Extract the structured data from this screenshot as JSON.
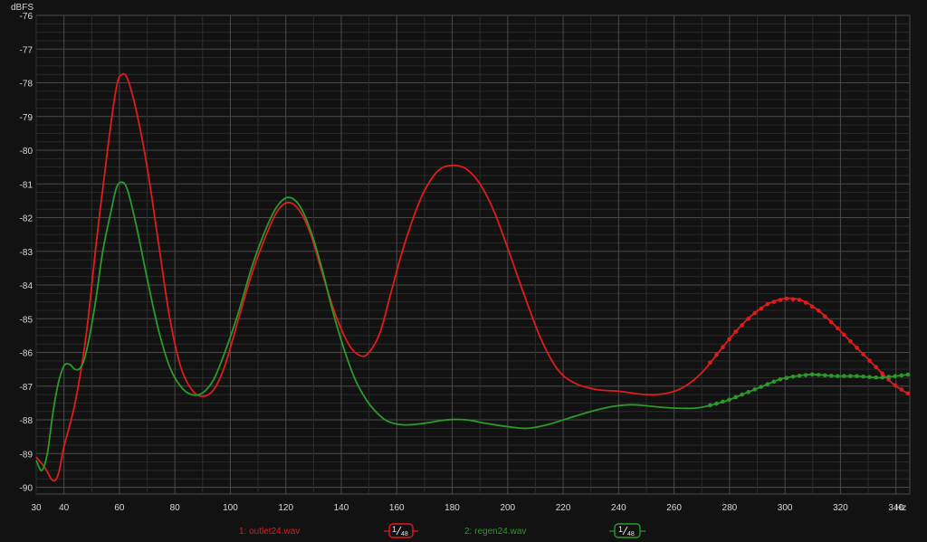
{
  "chart_data": {
    "type": "line",
    "y_unit": "dBFS",
    "x_unit": "Hz",
    "xlim": [
      30,
      345
    ],
    "ylim": [
      -90.2,
      -76
    ],
    "x_ticks": [
      "30",
      "40",
      "60",
      "80",
      "100",
      "120",
      "140",
      "160",
      "180",
      "200",
      "220",
      "240",
      "260",
      "280",
      "300",
      "320",
      "340"
    ],
    "y_ticks": [
      "-76",
      "-77",
      "-78",
      "-79",
      "-80",
      "-81",
      "-82",
      "-83",
      "-84",
      "-85",
      "-86",
      "-87",
      "-88",
      "-89",
      "-90"
    ],
    "grid": true,
    "background": "#121212",
    "grid_color": "#3a3a3a",
    "series": [
      {
        "name": "1: outlet24.wav",
        "smoothing": "1/48",
        "color": "#e01b1b",
        "points": [
          [
            30,
            -89.1
          ],
          [
            33,
            -89.4
          ],
          [
            36,
            -89.8
          ],
          [
            38,
            -89.6
          ],
          [
            40,
            -88.8
          ],
          [
            44,
            -87.5
          ],
          [
            48,
            -85.5
          ],
          [
            52,
            -82.5
          ],
          [
            56,
            -79.8
          ],
          [
            59,
            -78.1
          ],
          [
            61,
            -77.75
          ],
          [
            63,
            -77.9
          ],
          [
            66,
            -78.8
          ],
          [
            70,
            -80.5
          ],
          [
            74,
            -82.7
          ],
          [
            78,
            -84.9
          ],
          [
            82,
            -86.4
          ],
          [
            86,
            -87.1
          ],
          [
            90,
            -87.3
          ],
          [
            94,
            -87.1
          ],
          [
            98,
            -86.4
          ],
          [
            103,
            -85.0
          ],
          [
            108,
            -83.6
          ],
          [
            113,
            -82.5
          ],
          [
            117,
            -81.8
          ],
          [
            121,
            -81.55
          ],
          [
            125,
            -81.8
          ],
          [
            129,
            -82.5
          ],
          [
            133,
            -83.6
          ],
          [
            138,
            -84.9
          ],
          [
            143,
            -85.8
          ],
          [
            147,
            -86.1
          ],
          [
            150,
            -86.0
          ],
          [
            154,
            -85.4
          ],
          [
            158,
            -84.2
          ],
          [
            162,
            -83.0
          ],
          [
            166,
            -82.0
          ],
          [
            170,
            -81.2
          ],
          [
            175,
            -80.6
          ],
          [
            180,
            -80.45
          ],
          [
            185,
            -80.55
          ],
          [
            190,
            -81.0
          ],
          [
            195,
            -81.8
          ],
          [
            200,
            -82.9
          ],
          [
            206,
            -84.3
          ],
          [
            212,
            -85.6
          ],
          [
            218,
            -86.5
          ],
          [
            224,
            -86.9
          ],
          [
            232,
            -87.1
          ],
          [
            240,
            -87.15
          ],
          [
            250,
            -87.25
          ],
          [
            258,
            -87.2
          ],
          [
            264,
            -87.0
          ],
          [
            270,
            -86.6
          ],
          [
            276,
            -86.0
          ],
          [
            282,
            -85.4
          ],
          [
            288,
            -84.9
          ],
          [
            294,
            -84.55
          ],
          [
            300,
            -84.4
          ],
          [
            306,
            -84.45
          ],
          [
            312,
            -84.75
          ],
          [
            318,
            -85.2
          ],
          [
            324,
            -85.7
          ],
          [
            330,
            -86.2
          ],
          [
            336,
            -86.7
          ],
          [
            340,
            -87.0
          ],
          [
            345,
            -87.25
          ]
        ]
      },
      {
        "name": "2: regen24.wav",
        "smoothing": "1/48",
        "color": "#2a9a2a",
        "points": [
          [
            30,
            -89.2
          ],
          [
            32,
            -89.5
          ],
          [
            34,
            -89.0
          ],
          [
            36,
            -87.8
          ],
          [
            38,
            -86.9
          ],
          [
            40,
            -86.4
          ],
          [
            42,
            -86.35
          ],
          [
            44,
            -86.5
          ],
          [
            46,
            -86.45
          ],
          [
            48,
            -86.0
          ],
          [
            51,
            -84.7
          ],
          [
            54,
            -83.0
          ],
          [
            57,
            -81.8
          ],
          [
            59,
            -81.1
          ],
          [
            61,
            -80.95
          ],
          [
            63,
            -81.2
          ],
          [
            66,
            -82.2
          ],
          [
            70,
            -83.8
          ],
          [
            74,
            -85.3
          ],
          [
            78,
            -86.4
          ],
          [
            82,
            -87.0
          ],
          [
            86,
            -87.25
          ],
          [
            90,
            -87.2
          ],
          [
            94,
            -86.8
          ],
          [
            98,
            -86.0
          ],
          [
            103,
            -84.8
          ],
          [
            108,
            -83.4
          ],
          [
            113,
            -82.3
          ],
          [
            117,
            -81.65
          ],
          [
            121,
            -81.4
          ],
          [
            125,
            -81.65
          ],
          [
            129,
            -82.4
          ],
          [
            133,
            -83.5
          ],
          [
            137,
            -84.8
          ],
          [
            141,
            -85.9
          ],
          [
            145,
            -86.8
          ],
          [
            149,
            -87.4
          ],
          [
            153,
            -87.8
          ],
          [
            157,
            -88.05
          ],
          [
            163,
            -88.15
          ],
          [
            170,
            -88.1
          ],
          [
            178,
            -88.0
          ],
          [
            185,
            -88.0
          ],
          [
            192,
            -88.1
          ],
          [
            200,
            -88.2
          ],
          [
            207,
            -88.25
          ],
          [
            214,
            -88.15
          ],
          [
            222,
            -87.95
          ],
          [
            230,
            -87.75
          ],
          [
            238,
            -87.6
          ],
          [
            245,
            -87.55
          ],
          [
            252,
            -87.6
          ],
          [
            260,
            -87.65
          ],
          [
            268,
            -87.65
          ],
          [
            274,
            -87.55
          ],
          [
            280,
            -87.4
          ],
          [
            286,
            -87.2
          ],
          [
            292,
            -87.0
          ],
          [
            298,
            -86.8
          ],
          [
            304,
            -86.7
          ],
          [
            310,
            -86.65
          ],
          [
            318,
            -86.7
          ],
          [
            326,
            -86.7
          ],
          [
            334,
            -86.75
          ],
          [
            340,
            -86.7
          ],
          [
            345,
            -86.65
          ]
        ]
      }
    ]
  },
  "legend": [
    {
      "label": "1: outlet24.wav",
      "badge_num": "1",
      "badge_den": "48",
      "color": "#e01b1b"
    },
    {
      "label": "2: regen24.wav",
      "badge_num": "1",
      "badge_den": "48",
      "color": "#2a9a2a"
    }
  ]
}
